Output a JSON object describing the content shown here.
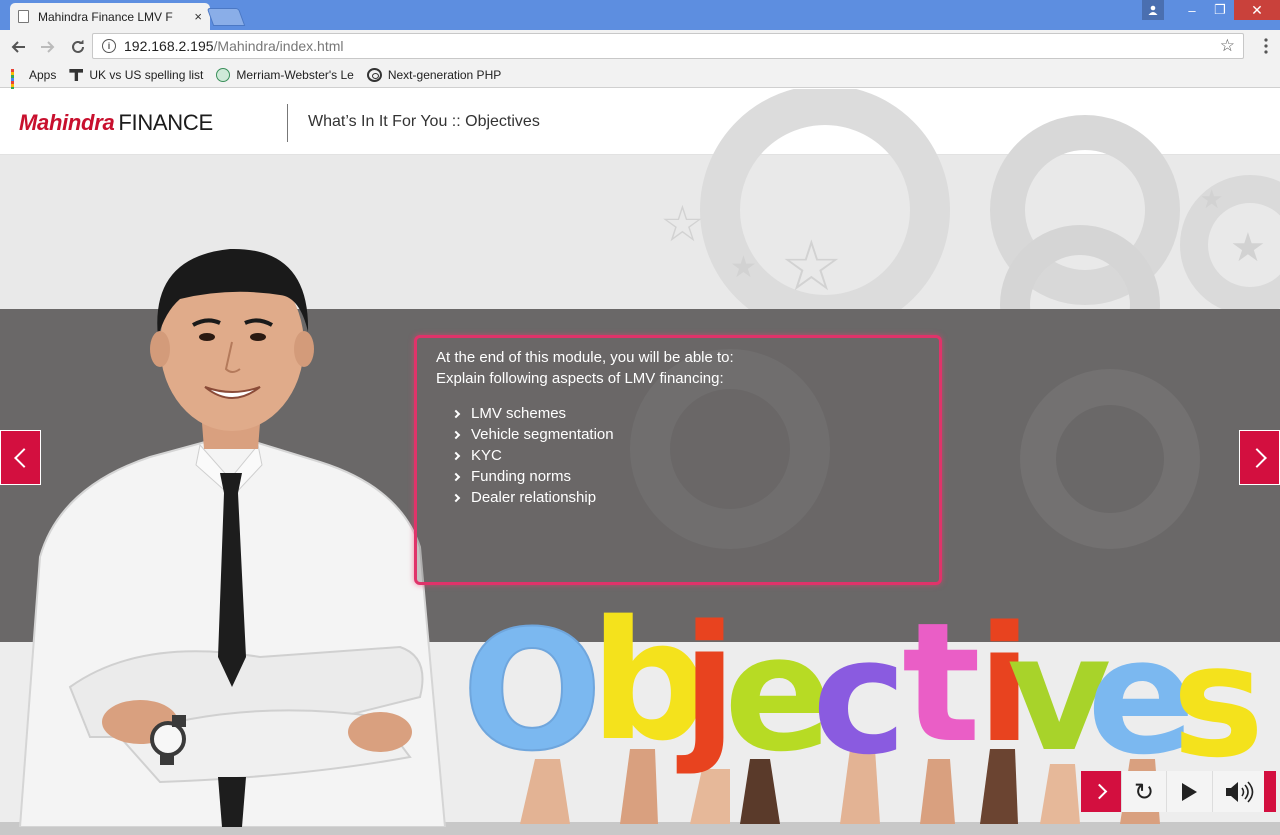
{
  "browser": {
    "tab_title": "Mahindra Finance LMV F",
    "tab_close": "×",
    "url_host": "192.168.2.195",
    "url_path": "/Mahindra/index.html",
    "bookmarks": [
      {
        "label": "Apps",
        "icon": "apps-grid-icon"
      },
      {
        "label": "UK vs US spelling list",
        "icon": "t-icon"
      },
      {
        "label": "Merriam-Webster's Le",
        "icon": "globe-icon"
      },
      {
        "label": "Next-generation PHP",
        "icon": "php-icon"
      }
    ],
    "window_buttons": {
      "minimize": "–",
      "restore": "❐",
      "close": "✕"
    }
  },
  "header": {
    "logo_brand": "Mahindra",
    "logo_suffix": "FINANCE",
    "title": "What’s In It For You :: Objectives"
  },
  "objectives": {
    "intro_line1": "At the end of this module, you will be able to:",
    "intro_line2": "Explain following aspects of LMV financing:",
    "items": [
      "LMV schemes",
      "Vehicle segmentation",
      "KYC",
      "Funding norms",
      "Dealer relationship"
    ]
  },
  "banner": {
    "letters": [
      {
        "char": "O",
        "color": "#7bb8f0"
      },
      {
        "char": "b",
        "color": "#f4e21c"
      },
      {
        "char": "j",
        "color": "#e8431f"
      },
      {
        "char": "e",
        "color": "#b7db24"
      },
      {
        "char": "c",
        "color": "#8a5be0"
      },
      {
        "char": "t",
        "color": "#ea5ec6"
      },
      {
        "char": "i",
        "color": "#e8431f"
      },
      {
        "char": "v",
        "color": "#a8d32a"
      },
      {
        "char": "e",
        "color": "#7bb8f0"
      },
      {
        "char": "s",
        "color": "#f4e21c"
      }
    ]
  },
  "controls": {
    "next": "next-icon",
    "replay": "↻",
    "play": "play-icon",
    "volume": "volume-icon"
  },
  "colors": {
    "accent": "#d30f3f",
    "box_border": "#e0336a",
    "band": "#6a6868"
  }
}
